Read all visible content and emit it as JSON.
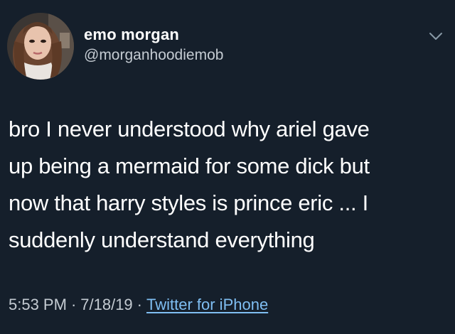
{
  "tweet": {
    "author": {
      "display_name": "emo morgan",
      "handle": "@morganhoodiemob",
      "avatar_icon": "avatar-photo"
    },
    "menu_icon": "chevron-down-icon",
    "body_lines": [
      "bro I never understood why ariel gave",
      "up being a mermaid for some dick but",
      "now that harry styles is prince eric ... I",
      "suddenly understand everything"
    ],
    "meta": {
      "time": "5:53 PM",
      "date": "7/18/19",
      "separator": "·",
      "source": "Twitter for iPhone"
    }
  },
  "colors": {
    "background": "#151f2b",
    "primary_text": "#ffffff",
    "secondary_text": "#c4cbd2",
    "link": "#7fbef2"
  }
}
